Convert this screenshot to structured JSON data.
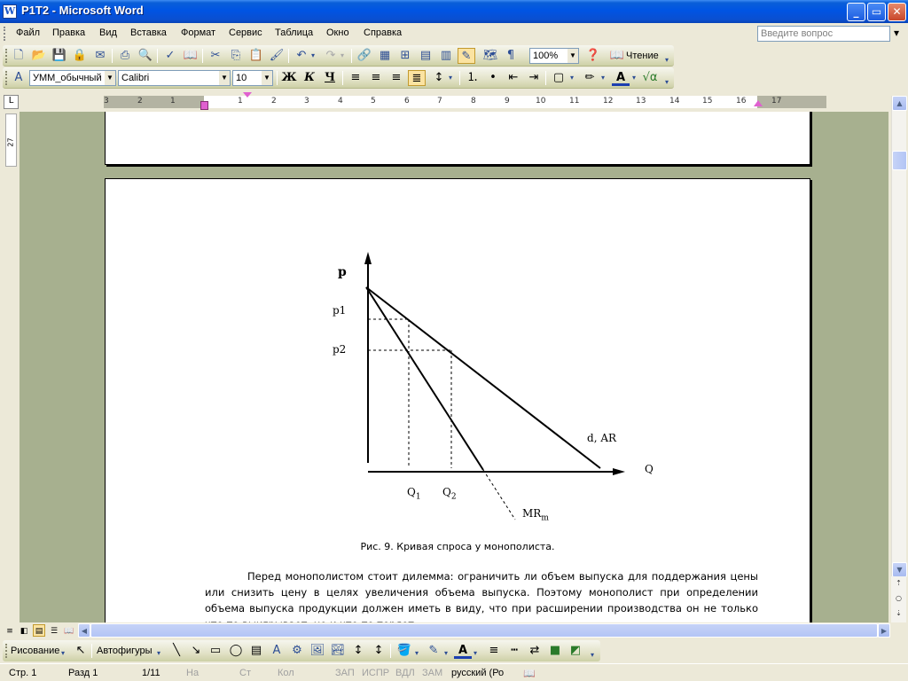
{
  "window": {
    "title": "P1T2 - Microsoft Word",
    "app_icon": "W",
    "controls": [
      "_",
      "▭",
      "✕"
    ]
  },
  "menu": {
    "items": [
      "Файл",
      "Правка",
      "Вид",
      "Вставка",
      "Формат",
      "Сервис",
      "Таблица",
      "Окно",
      "Справка"
    ],
    "ask_placeholder": "Введите вопрос"
  },
  "standard_toolbar": {
    "zoom": "100%",
    "reading_label": "Чтение"
  },
  "formatting_toolbar": {
    "style": "УММ_обычный",
    "font": "Calibri",
    "size": "10",
    "bold": "Ж",
    "italic": "К",
    "underline": "Ч"
  },
  "ruler": {
    "ticks": [
      "3",
      "2",
      "1",
      "1",
      "2",
      "3",
      "4",
      "5",
      "6",
      "7",
      "8",
      "9",
      "10",
      "11",
      "12",
      "13",
      "14",
      "15",
      "16",
      "17"
    ],
    "vertical_label": "27"
  },
  "figure": {
    "y_axis_label": "p",
    "x_axis_label": "Q",
    "p1": "p1",
    "p2": "p2",
    "q1_base": "Q",
    "q1_sub": "1",
    "q2_base": "Q",
    "q2_sub": "2",
    "demand_d": "d",
    "demand_ar": ", AR",
    "mr_base": "MR",
    "mr_sub": "m"
  },
  "caption": "Рис. 9. Кривая спроса у монополиста.",
  "body_paragraph": "Перед монополистом стоит дилемма: ограничить ли объем выпуска для поддержания цены или снизить цену в целях увеличения объема выпуска. Поэтому монополист при определении объема выпуска продукции должен иметь в виду, что при расширении производства он не только что-то выигрывает, но и что-то теряет.",
  "drawing_toolbar": {
    "draw_label": "Рисование",
    "autoshapes_label": "Автофигуры"
  },
  "status": {
    "page": "Стр. 1",
    "section": "Разд 1",
    "pages": "1/11",
    "at": "На",
    "line": "Ст",
    "col": "Кол",
    "rec": "ЗАП",
    "trk": "ИСПР",
    "ext": "ВДЛ",
    "ovr": "ЗАМ",
    "lang": "русский (Ро"
  }
}
